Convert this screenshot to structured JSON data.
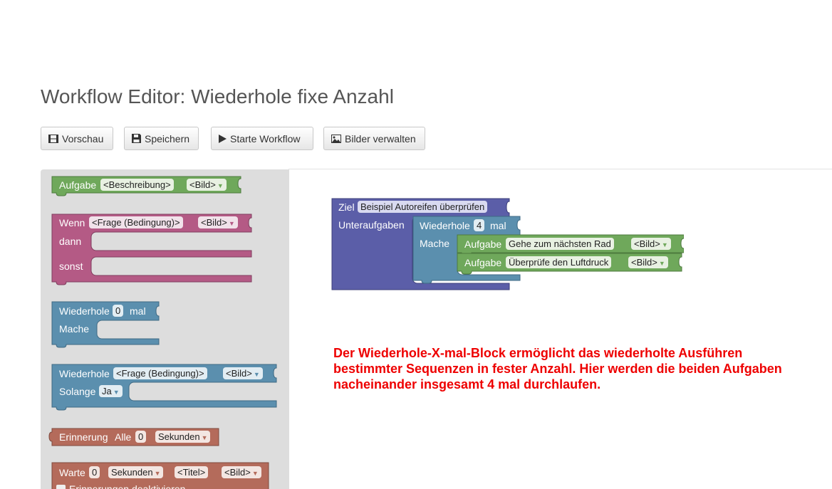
{
  "header": {
    "title": "Workflow Editor: Wiederhole fixe Anzahl"
  },
  "toolbar": {
    "preview": {
      "label": "Vorschau",
      "icon": "film-icon"
    },
    "save": {
      "label": "Speichern",
      "icon": "floppy-disk-icon"
    },
    "start": {
      "label": "Starte Workflow",
      "icon": "play-icon"
    },
    "images": {
      "label": "Bilder verwalten",
      "icon": "picture-icon"
    }
  },
  "colors": {
    "green": "#6fa85b",
    "pink": "#b45a85",
    "teal": "#5b8fae",
    "brown": "#b46b5b",
    "purple": "#5b5ea8",
    "caption": "#ee0000"
  },
  "toolbox": {
    "aufgabe": {
      "label": "Aufgabe",
      "desc": "<Beschreibung>",
      "image": "<Bild>"
    },
    "wenn": {
      "label": "Wenn",
      "question": "<Frage (Bedingung)>",
      "image": "<Bild>",
      "then": "dann",
      "else": "sonst"
    },
    "repeat_n": {
      "label": "Wiederhole",
      "count": "0",
      "unit": "mal",
      "do": "Mache"
    },
    "repeat_while": {
      "label": "Wiederhole",
      "question": "<Frage (Bedingung)>",
      "image": "<Bild>",
      "while": "Solange",
      "answer": "Ja"
    },
    "reminder": {
      "label": "Erinnerung",
      "every": "Alle",
      "count": "0",
      "unit": "Sekunden"
    },
    "wait": {
      "label": "Warte",
      "count": "0",
      "unit": "Sekunden",
      "title": "<Titel>",
      "image": "<Bild>",
      "checkbox": "Erinnerungen deaktivieren"
    }
  },
  "workspace": {
    "goal": {
      "label": "Ziel",
      "value": "Beispiel Autoreifen überprüfen",
      "subtasks": "Unteraufgaben"
    },
    "repeat": {
      "label": "Wiederhole",
      "count": "4",
      "unit": "mal",
      "do": "Mache"
    },
    "tasks": [
      {
        "label": "Aufgabe",
        "desc": "Gehe zum nächsten Rad",
        "image": "<Bild>"
      },
      {
        "label": "Aufgabe",
        "desc": "Überprüfe den Luftdruck",
        "image": "<Bild>"
      }
    ]
  },
  "caption": "Der Wiederhole-X-mal-Block ermöglicht das wiederholte Ausführen bestimmter Sequenzen in fester Anzahl. Hier werden die beiden Aufgaben nacheinander insgesamt 4 mal durchlaufen."
}
